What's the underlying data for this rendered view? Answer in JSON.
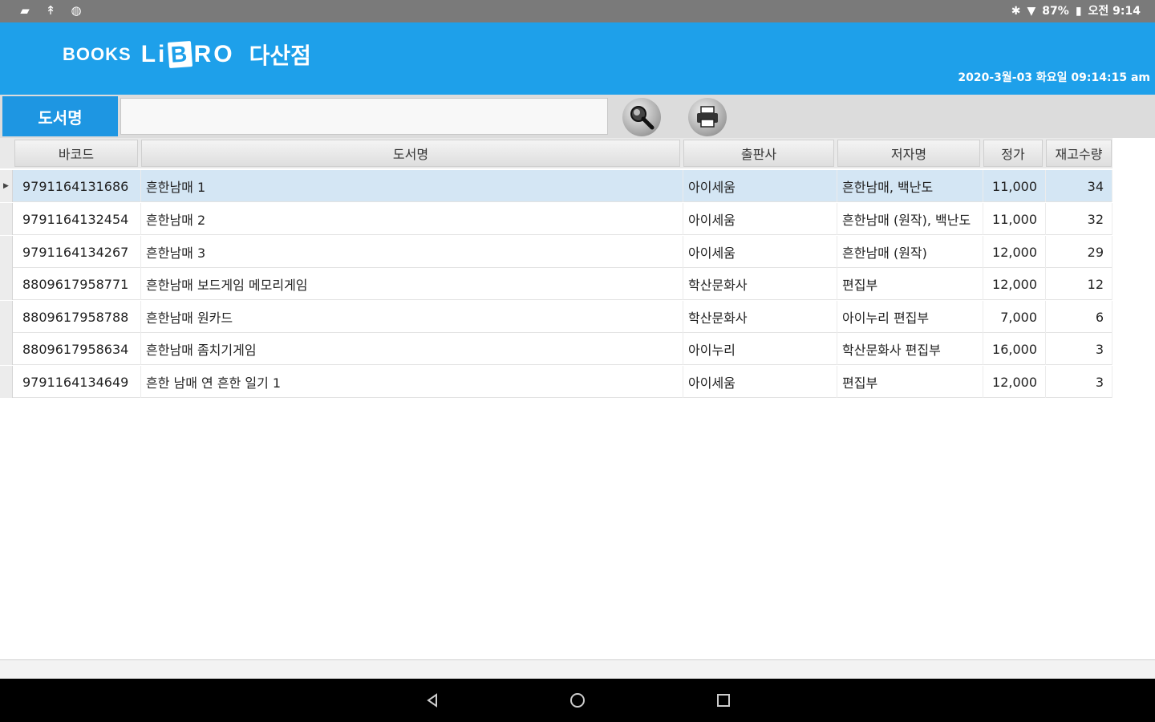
{
  "status_bar": {
    "battery": "87%",
    "time": "오전 9:14"
  },
  "header": {
    "logo_books": "BOOKS",
    "logo_libro": "LIBRO",
    "branch": "다산점",
    "datetime": "2020-3월-03 화요일 09:14:15 am"
  },
  "search": {
    "label": "도서명",
    "value": "",
    "placeholder": ""
  },
  "table": {
    "columns": [
      "바코드",
      "도서명",
      "출판사",
      "저자명",
      "정가",
      "재고수량"
    ],
    "rows": [
      {
        "barcode": "9791164131686",
        "title": "흔한남매 1",
        "publisher": "아이세움",
        "author": "흔한남매, 백난도",
        "price": "11,000",
        "stock": "34"
      },
      {
        "barcode": "9791164132454",
        "title": "흔한남매 2",
        "publisher": "아이세움",
        "author": "흔한남매 (원작), 백난도",
        "price": "11,000",
        "stock": "32"
      },
      {
        "barcode": "9791164134267",
        "title": "흔한남매 3",
        "publisher": "아이세움",
        "author": "흔한남매 (원작)",
        "price": "12,000",
        "stock": "29"
      },
      {
        "barcode": "8809617958771",
        "title": "흔한남매 보드게임 메모리게임",
        "publisher": "학산문화사",
        "author": "편집부",
        "price": "12,000",
        "stock": "12"
      },
      {
        "barcode": "8809617958788",
        "title": "흔한남매 원카드",
        "publisher": "학산문화사",
        "author": "아이누리 편집부",
        "price": "7,000",
        "stock": "6"
      },
      {
        "barcode": "8809617958634",
        "title": "흔한남매 좀치기게임",
        "publisher": "아이누리",
        "author": "학산문화사 편집부",
        "price": "16,000",
        "stock": "3"
      },
      {
        "barcode": "9791164134649",
        "title": "흔한 남매 연 흔한 일기 1",
        "publisher": "아이세움",
        "author": "편집부",
        "price": "12,000",
        "stock": "3"
      }
    ]
  },
  "nav": {
    "back_icon": "back-icon",
    "home_icon": "home-icon",
    "recents_icon": "recents-icon"
  }
}
